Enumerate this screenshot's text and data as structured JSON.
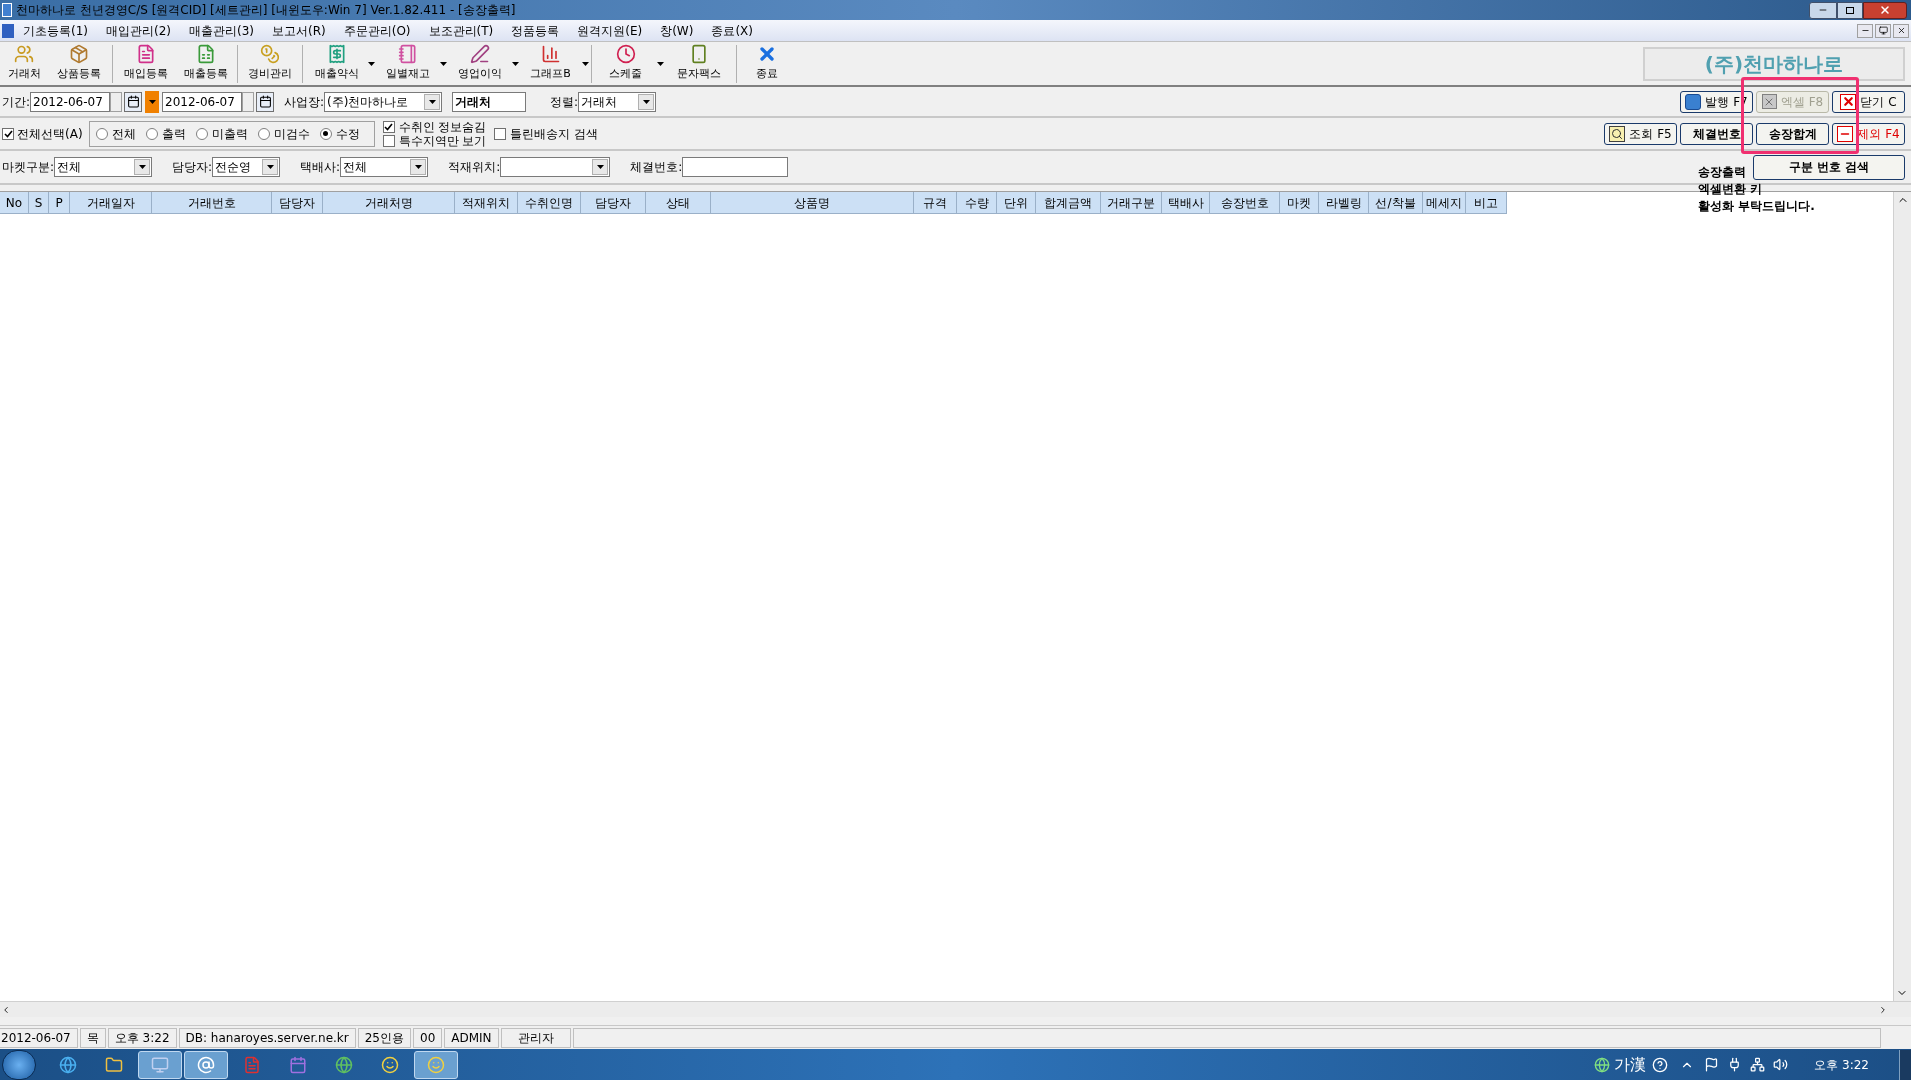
{
  "window": {
    "title": "천마하나로 천년경영C/S [원격CID] [세트관리] [내윈도우:Win 7] Ver.1.82.411 - [송장출력]"
  },
  "menu": [
    "기초등록(1)",
    "매입관리(2)",
    "매출관리(3)",
    "보고서(R)",
    "주문관리(O)",
    "보조관리(T)",
    "정품등록",
    "원격지원(E)",
    "창(W)",
    "종료(X)"
  ],
  "toolbar": [
    {
      "label": "거래처",
      "dropdown": false
    },
    {
      "label": "상품등록",
      "dropdown": false
    },
    {
      "label": "매입등록",
      "dropdown": false
    },
    {
      "label": "매출등록",
      "dropdown": false
    },
    {
      "label": "경비관리",
      "dropdown": false
    },
    {
      "label": "매출약식",
      "dropdown": true
    },
    {
      "label": "일별재고",
      "dropdown": true
    },
    {
      "label": "영업이익",
      "dropdown": true
    },
    {
      "label": "그래프B",
      "dropdown": true
    },
    {
      "label": "스케줄",
      "dropdown": true
    },
    {
      "label": "문자팩스",
      "dropdown": false
    },
    {
      "label": "종료",
      "dropdown": false
    }
  ],
  "company": "(주)천마하나로",
  "filters": {
    "period_label": "기간:",
    "date_from": "2012-06-07",
    "date_to": "2012-06-07",
    "workplace_label": "사업장:",
    "workplace": "(주)천마하나로",
    "partner": "거래처",
    "sort_label": "정렬:",
    "sort": "거래처"
  },
  "select_all": {
    "label": "전체선택(A)",
    "checked": true
  },
  "radios": [
    {
      "label": "전체",
      "selected": false
    },
    {
      "label": "출력",
      "selected": false
    },
    {
      "label": "미출력",
      "selected": false
    },
    {
      "label": "미검수",
      "selected": false
    },
    {
      "label": "수정",
      "selected": true
    }
  ],
  "checkboxes": [
    {
      "label": "수취인 정보숨김",
      "checked": true
    },
    {
      "label": "특수지역만 보기",
      "checked": false
    },
    {
      "label": "틀린배송지 검색",
      "checked": false
    }
  ],
  "fields": [
    {
      "label": "마켓구분:",
      "value": "전체",
      "kind": "select"
    },
    {
      "label": "담당자:",
      "value": "전순영",
      "kind": "select"
    },
    {
      "label": "택배사:",
      "value": "전체",
      "kind": "select"
    },
    {
      "label": "적재위치:",
      "kind": "select"
    },
    {
      "label": "체결번호:",
      "kind": "input"
    }
  ],
  "buttons_row1": [
    {
      "label": "발행 F7",
      "kind": "print",
      "disabled": false
    },
    {
      "label": "엑셀 F8",
      "kind": "excel",
      "disabled": true
    },
    {
      "label": "닫기 C",
      "kind": "close",
      "disabled": false
    }
  ],
  "buttons_row2": [
    {
      "label": "조회 F5",
      "kind": "search",
      "disabled": false
    },
    {
      "label": "체결번호",
      "kind": "plain",
      "disabled": false
    },
    {
      "label": "송장합계",
      "kind": "plain",
      "disabled": false
    },
    {
      "label": "제외 F4",
      "kind": "exclude",
      "disabled": false
    }
  ],
  "search_button": "구분 번호 검색",
  "note": [
    "송장출력",
    "엑셀변환 키",
    "활성화 부탁드립니다."
  ],
  "table": {
    "columns": [
      "No",
      "S",
      "P",
      "거래일자",
      "거래번호",
      "담당자",
      "거래처명",
      "적재위치",
      "수취인명",
      "담당자",
      "상태",
      "상품명",
      "규격",
      "수량",
      "단위",
      "합계금액",
      "거래구분",
      "택배사",
      "송장번호",
      "마켓",
      "라벨링",
      "선/착불",
      "메세지",
      "비고"
    ]
  },
  "status_bar": [
    "2012-06-07",
    "목",
    "오후 3:22",
    "DB: hanaroyes.server.ne.kr",
    "25인용",
    "00",
    "ADMIN",
    "관리자"
  ],
  "taskbar": {
    "buttons": [
      {
        "active": false
      },
      {
        "active": false
      },
      {
        "active": true
      },
      {
        "active": true
      },
      {
        "active": false
      },
      {
        "active": false
      },
      {
        "active": false
      },
      {
        "active": false
      },
      {
        "active": true
      }
    ],
    "ime": "가漢",
    "clock": "오후 3:22"
  }
}
